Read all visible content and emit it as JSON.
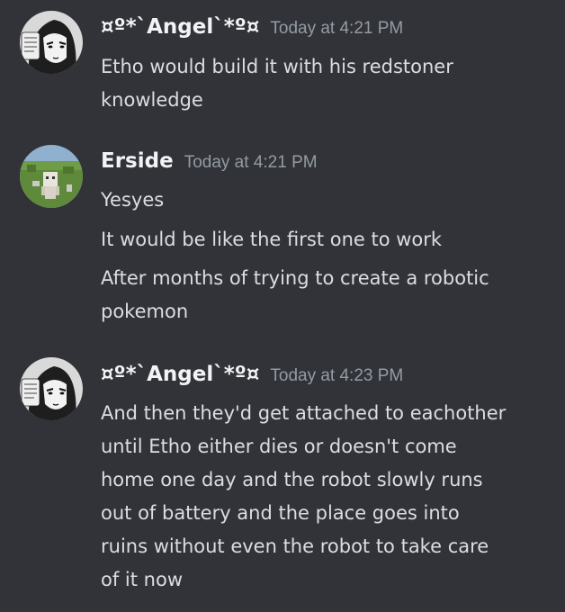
{
  "colors": {
    "background": "#313338",
    "username": "#f2f3f5",
    "text": "#dbdee1",
    "timestamp": "#949ba4"
  },
  "messages": [
    {
      "author": "¤º*`Angel`*º¤",
      "timestamp": "Today at 4:21 PM",
      "avatar": "anime-manga-avatar",
      "lines": [
        "Etho would build it with his redstoner\nknowledge"
      ]
    },
    {
      "author": "Erside",
      "timestamp": "Today at 4:21 PM",
      "avatar": "minecraft-grass-avatar",
      "lines": [
        "Yesyes",
        "It would be like the first one to work",
        "After months of trying to create a robotic\npokemon"
      ]
    },
    {
      "author": "¤º*`Angel`*º¤",
      "timestamp": "Today at 4:23 PM",
      "avatar": "anime-manga-avatar",
      "lines": [
        "And then they'd get attached to eachother\nuntil Etho either dies or doesn't come\nhome one day and the robot slowly runs\nout of battery and the place goes into\nruins without even the robot to take care\nof it now"
      ]
    }
  ]
}
